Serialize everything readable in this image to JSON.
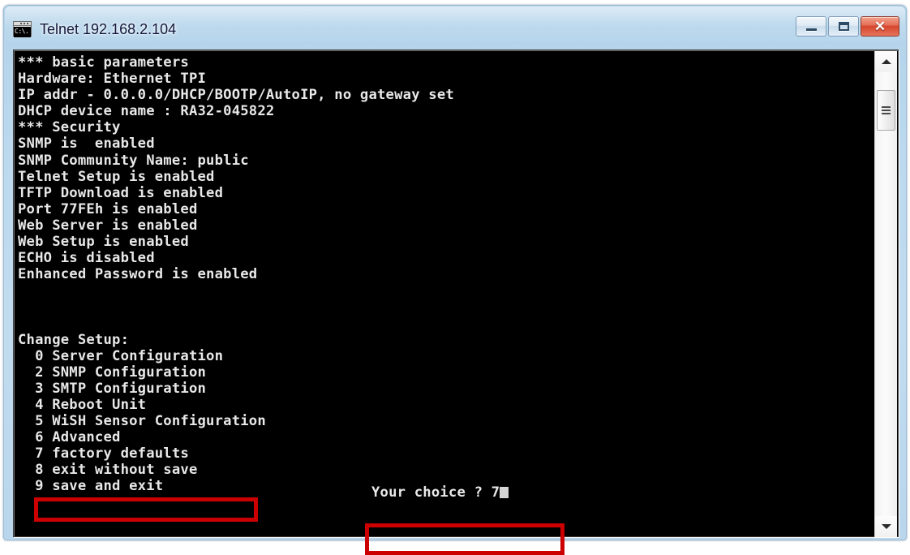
{
  "window": {
    "title": "Telnet 192.168.2.104",
    "icon": "console-icon",
    "icon_prompt_text": "C:\\.",
    "frame_color": "#bcd9ee",
    "caption_buttons": [
      {
        "name": "minimize",
        "label": "Minimize"
      },
      {
        "name": "maximize",
        "label": "Maximize"
      },
      {
        "name": "close",
        "label": "Close",
        "glyph": "✕",
        "color": "#d4452c"
      }
    ]
  },
  "terminal": {
    "background": "#000000",
    "foreground": "#e8e8e8",
    "lines": [
      "*** basic parameters",
      "Hardware: Ethernet TPI",
      "IP addr - 0.0.0.0/DHCP/BOOTP/AutoIP, no gateway set",
      "DHCP device name : RA32-045822",
      "*** Security",
      "SNMP is  enabled",
      "SNMP Community Name: public",
      "Telnet Setup is enabled",
      "TFTP Download is enabled",
      "Port 77FEh is enabled",
      "Web Server is enabled",
      "Web Setup is enabled",
      "ECHO is disabled",
      "Enhanced Password is enabled",
      "",
      "",
      "",
      "Change Setup:",
      "  0 Server Configuration",
      "  2 SNMP Configuration",
      "  3 SMTP Configuration",
      "  4 Reboot Unit",
      "  5 WiSH Sensor Configuration",
      "  6 Advanced",
      "  7 factory defaults",
      "  8 exit without save",
      "  9 save and exit"
    ],
    "menu": {
      "header": "Change Setup:",
      "items": [
        {
          "key": "0",
          "label": "Server Configuration"
        },
        {
          "key": "2",
          "label": "SNMP Configuration"
        },
        {
          "key": "3",
          "label": "SMTP Configuration"
        },
        {
          "key": "4",
          "label": "Reboot Unit"
        },
        {
          "key": "5",
          "label": "WiSH Sensor Configuration"
        },
        {
          "key": "6",
          "label": "Advanced"
        },
        {
          "key": "7",
          "label": "factory defaults"
        },
        {
          "key": "8",
          "label": "exit without save"
        },
        {
          "key": "9",
          "label": "save and exit"
        }
      ]
    },
    "prompt": {
      "text": "Your choice ? 7",
      "typed_value": "7",
      "cursor": "block-cursor"
    },
    "basic_parameters": {
      "heading": "*** basic parameters",
      "hardware": "Ethernet TPI",
      "ip_addr": "0.0.0.0/DHCP/BOOTP/AutoIP, no gateway set",
      "dhcp_device_name": "RA32-045822"
    },
    "security": {
      "heading": "*** Security",
      "snmp": "enabled",
      "snmp_community_name": "public",
      "telnet_setup": "enabled",
      "tftp_download": "enabled",
      "port_77feh": "enabled",
      "web_server": "enabled",
      "web_setup": "enabled",
      "echo": "disabled",
      "enhanced_password": "enabled"
    }
  },
  "annotations": {
    "color": "#cc0000",
    "boxes": [
      {
        "name": "factory-defaults-highlight",
        "target": "7 factory defaults"
      },
      {
        "name": "your-choice-highlight",
        "target": "Your choice ? 7"
      }
    ]
  },
  "scrollbar": {
    "up_arrow": "▲",
    "down_arrow": "▼",
    "thumb": "scroll-thumb"
  }
}
